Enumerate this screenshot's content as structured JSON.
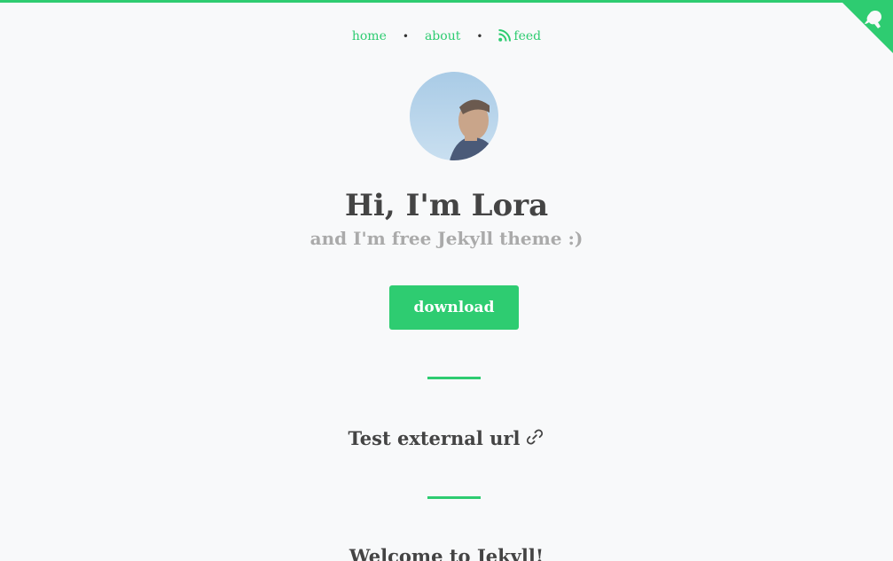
{
  "nav": {
    "items": [
      {
        "label": "home"
      },
      {
        "label": "about"
      },
      {
        "label": "feed"
      }
    ],
    "separator": "•"
  },
  "hero": {
    "title": "Hi, I'm Lora",
    "subtitle": "and I'm free Jekyll theme :)",
    "download_label": "download"
  },
  "posts": [
    {
      "title": "Test external url"
    },
    {
      "title": "Welcome to Jekyll!"
    }
  ],
  "colors": {
    "accent": "#2ecc71",
    "text": "#444444",
    "muted": "#aaaaaa",
    "background": "#f8f9fa"
  },
  "icons": {
    "feed": "rss-icon",
    "external_link": "link-icon",
    "corner": "github-octocat-icon"
  }
}
